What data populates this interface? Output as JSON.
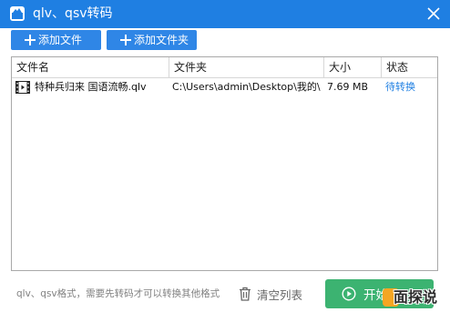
{
  "window": {
    "title": "qlv、qsv转码",
    "icon": "app-convert-icon",
    "close_icon": "close-icon"
  },
  "toolbar": {
    "add_file_label": "添加文件",
    "add_folder_label": "添加文件夹"
  },
  "table": {
    "columns": [
      "文件名",
      "文件夹",
      "大小",
      "状态"
    ],
    "rows": [
      {
        "icon": "video-file-icon",
        "name": "特种兵归来 国语流畅.qlv",
        "folder": "C:\\Users\\admin\\Desktop\\我的\\",
        "size": "7.69 MB",
        "status": "待转换"
      }
    ]
  },
  "footer": {
    "hint": "qlv、qsv格式，需要先转码才可以转换其他格式",
    "clear_label": "清空列表",
    "start_label": "开始",
    "watermark": "面探说"
  },
  "colors": {
    "title_bar": "#1f7fe2",
    "toolbar_button": "#2f86e6",
    "start_button": "#3cb371",
    "status_link": "#1f7fe2"
  }
}
